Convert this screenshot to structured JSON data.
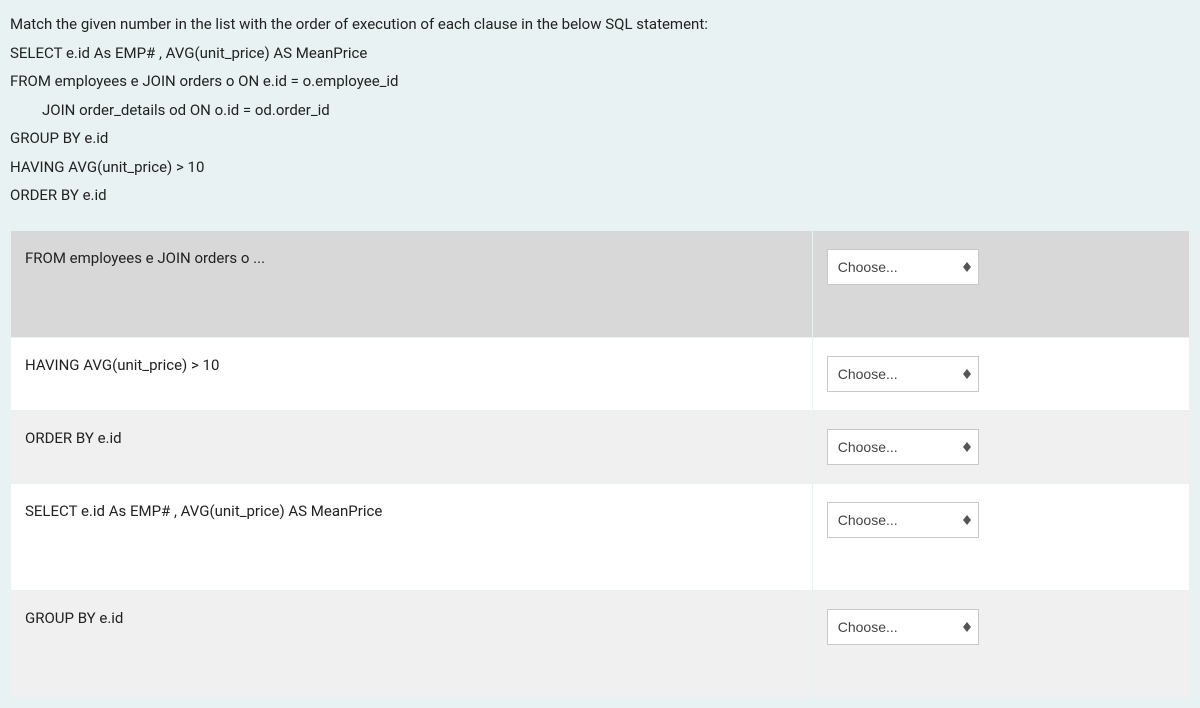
{
  "question": {
    "intro": "Match the given number in the list with the order of execution of each clause in the below SQL statement:",
    "lines": [
      "SELECT e.id As EMP# ,  AVG(unit_price) AS MeanPrice",
      "FROM employees e  JOIN orders o  ON e.id = o.employee_id",
      "JOIN order_details od ON o.id = od.order_id",
      "GROUP BY e.id",
      "HAVING AVG(unit_price) > 10",
      "ORDER BY e.id"
    ]
  },
  "rows": [
    {
      "label": "FROM employees e  JOIN orders o  ...",
      "placeholder": "Choose...",
      "bg": "row-alt-1",
      "tall": true
    },
    {
      "label": "HAVING AVG(unit_price) > 10",
      "placeholder": "Choose...",
      "bg": "row-alt-2",
      "tall": false
    },
    {
      "label": "ORDER BY e.id",
      "placeholder": "Choose...",
      "bg": "row-alt-3",
      "tall": false
    },
    {
      "label": "SELECT e.id As EMP# ,  AVG(unit_price) AS MeanPrice",
      "placeholder": "Choose...",
      "bg": "row-alt-2",
      "tall": true
    },
    {
      "label": "GROUP BY e.id",
      "placeholder": "Choose...",
      "bg": "row-alt-3",
      "tall": true
    }
  ]
}
